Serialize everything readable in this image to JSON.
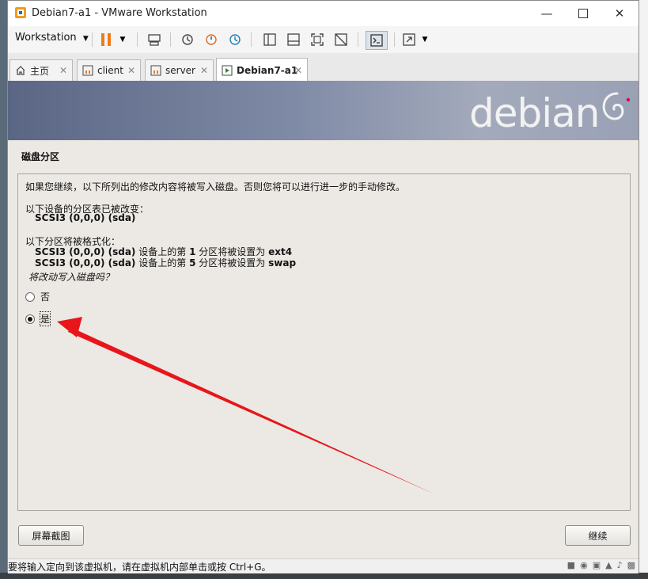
{
  "window": {
    "title": "Debian7-a1 - VMware Workstation",
    "minimize_icon": "minimize-icon",
    "maximize_icon": "maximize-icon",
    "close_icon": "close-icon"
  },
  "toolbar": {
    "workstation_label": "Workstation"
  },
  "tabs": [
    {
      "label": "主页",
      "icon": "home-icon"
    },
    {
      "label": "client",
      "icon": "vm-icon"
    },
    {
      "label": "server",
      "icon": "vm-icon"
    },
    {
      "label": "Debian7-a1",
      "icon": "vm-icon",
      "active": true
    }
  ],
  "installer": {
    "brand": "debian",
    "section_title": "磁盘分区",
    "intro": "如果您继续，以下所列出的修改内容将被写入磁盘。否则您将可以进行进一步的手动修改。",
    "changed_tables_heading": "以下设备的分区表已被改变：",
    "changed_device": "SCSI3 (0,0,0) (sda)",
    "format_heading": "以下分区将被格式化：",
    "format_line1_dev": "SCSI3 (0,0,0) (sda)",
    "format_line1_mid": "设备上的第",
    "format_line1_num": "1",
    "format_line1_mid2": "分区将被设置为",
    "format_line1_fs": "ext4",
    "format_line2_dev": "SCSI3 (0,0,0) (sda)",
    "format_line2_mid": "设备上的第",
    "format_line2_num": "5",
    "format_line2_mid2": "分区将被设置为",
    "format_line2_fs": "swap",
    "question": "将改动写入磁盘吗？",
    "option_no": "否",
    "option_yes": "是",
    "selected": "是",
    "screenshot_button": "屏幕截图",
    "continue_button": "继续"
  },
  "statusbar": {
    "text": "要将输入定向到该虚拟机，请在虚拟机内部单击或按 Ctrl+G。"
  },
  "colors": {
    "arrow": "#e8161b",
    "pause_orange": "#f07a1a"
  }
}
